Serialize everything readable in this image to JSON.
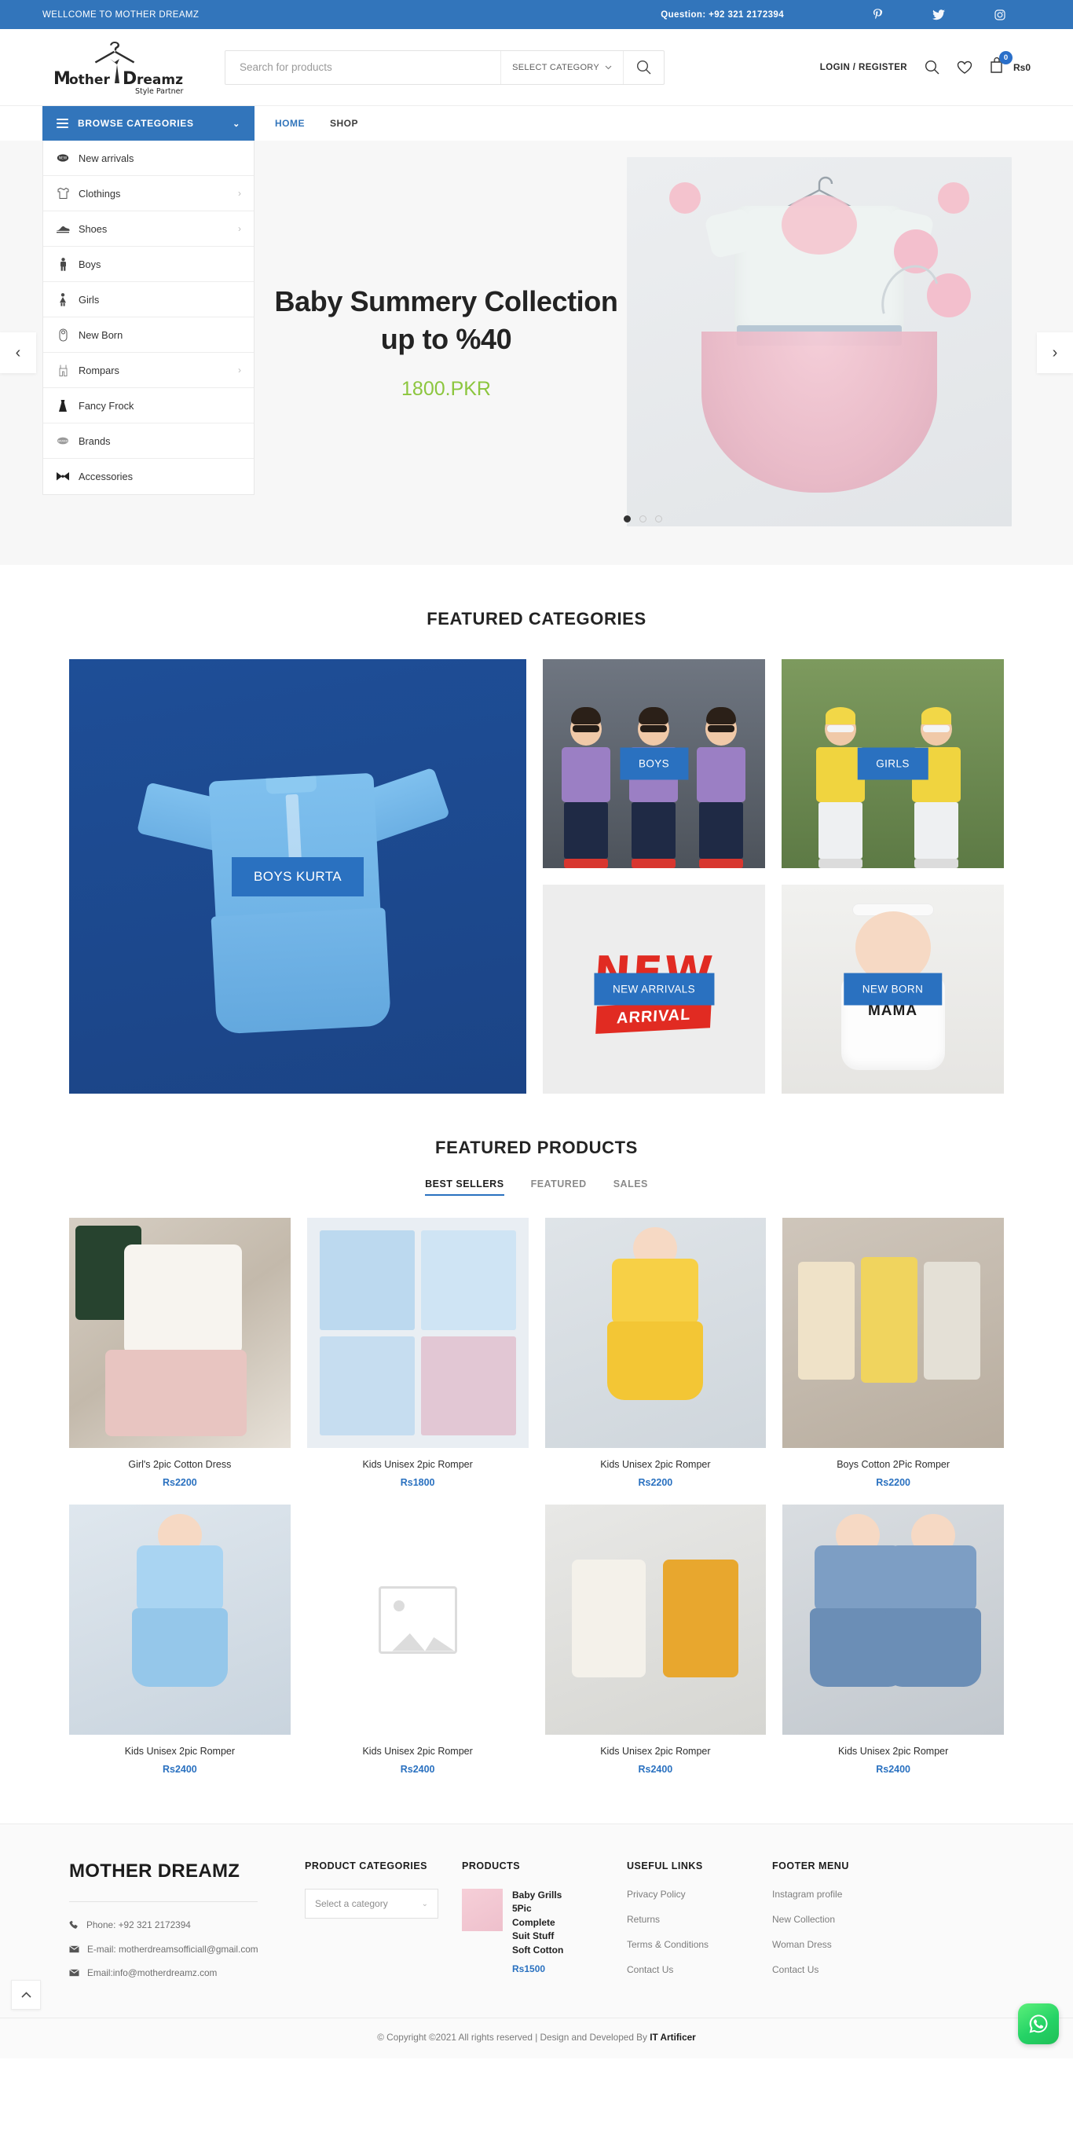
{
  "topbar": {
    "welcome": "WELLCOME TO MOTHER DREAMZ",
    "question": "Question: +92 321 2172394",
    "socials": [
      {
        "name": "pinterest-icon",
        "label": "Pinterest"
      },
      {
        "name": "twitter-icon",
        "label": "Twitter"
      },
      {
        "name": "instagram-icon",
        "label": "Instagram"
      }
    ]
  },
  "header": {
    "logo_name": "Mother",
    "logo_name2": "reamz",
    "logo_tagline": "Style Partner",
    "search_placeholder": "Search for products",
    "search_value": "",
    "select_category": "SELECT CATEGORY",
    "login": "LOGIN / REGISTER",
    "cart_count": "0",
    "cart_total": "Rs0"
  },
  "nav": {
    "browse": "BROWSE CATEGORIES",
    "links": [
      {
        "label": "HOME",
        "active": true
      },
      {
        "label": "SHOP",
        "active": false
      }
    ]
  },
  "categories": [
    {
      "label": "New arrivals",
      "has_sub": false,
      "icon": "new-badge-icon"
    },
    {
      "label": "Clothings",
      "has_sub": true,
      "icon": "shirt-icon"
    },
    {
      "label": "Shoes",
      "has_sub": true,
      "icon": "shoe-icon"
    },
    {
      "label": "Boys",
      "has_sub": false,
      "icon": "boy-icon"
    },
    {
      "label": "Girls",
      "has_sub": false,
      "icon": "girl-icon"
    },
    {
      "label": "New Born",
      "has_sub": false,
      "icon": "baby-icon"
    },
    {
      "label": "Rompars",
      "has_sub": true,
      "icon": "romper-icon"
    },
    {
      "label": "Fancy Frock",
      "has_sub": false,
      "icon": "dress-icon"
    },
    {
      "label": "Brands",
      "has_sub": false,
      "icon": "brand-icon"
    },
    {
      "label": "Accessories",
      "has_sub": false,
      "icon": "bow-icon"
    }
  ],
  "hero": {
    "title": "Baby Summery Collection up to %40",
    "price": "1800.PKR",
    "prev": "‹",
    "next": "›",
    "dots": [
      true,
      false,
      false
    ]
  },
  "featured_categories": {
    "title": "FEATURED CATEGORIES",
    "items": [
      {
        "label": "BOYS KURTA",
        "style": "big"
      },
      {
        "label": "BOYS",
        "style": "small"
      },
      {
        "label": "GIRLS",
        "style": "small"
      },
      {
        "label": "NEW ARRIVALS",
        "style": "small"
      },
      {
        "label": "NEW BORN",
        "style": "small"
      }
    ]
  },
  "featured_products": {
    "title": "FEATURED PRODUCTS",
    "tabs": [
      {
        "label": "BEST SELLERS",
        "active": true
      },
      {
        "label": "FEATURED",
        "active": false
      },
      {
        "label": "SALES",
        "active": false
      }
    ],
    "items": [
      {
        "name": "Girl's 2pic Cotton Dress",
        "price": "Rs2200"
      },
      {
        "name": "Kids Unisex 2pic Romper",
        "price": "Rs1800"
      },
      {
        "name": "Kids Unisex 2pic Romper",
        "price": "Rs2200"
      },
      {
        "name": "Boys Cotton 2Pic Romper",
        "price": "Rs2200"
      },
      {
        "name": "Kids Unisex 2pic Romper",
        "price": "Rs2400"
      },
      {
        "name": "Kids Unisex 2pic Romper",
        "price": "Rs2400"
      },
      {
        "name": "Kids Unisex 2pic Romper",
        "price": "Rs2400"
      },
      {
        "name": "Kids Unisex 2pic Romper",
        "price": "Rs2400"
      }
    ]
  },
  "footer": {
    "brand": "MOTHER DREAMZ",
    "phone": "Phone: +92 321 2172394",
    "email1": "E-mail: motherdreamsofficiall@gmail.com",
    "email2": "Email:info@motherdreamz.com",
    "categories_head": "PRODUCT CATEGORIES",
    "categories_select": "Select a category",
    "products_head": "PRODUCTS",
    "product": {
      "name": "Baby Grills 5Pic Complete Suit Stuff Soft Cotton",
      "price": "Rs1500"
    },
    "useful_head": "USEFUL LINKS",
    "useful_links": [
      "Privacy Policy",
      "Returns",
      "Terms & Conditions",
      "Contact Us"
    ],
    "menu_head": "FOOTER MENU",
    "menu_links": [
      "Instagram profile",
      "New Collection",
      "Woman Dress",
      "Contact Us"
    ],
    "copyright_pre": "© Copyright ©2021 All rights reserved | Design and Developed By ",
    "copyright_brand": "IT Artificer"
  },
  "floating": {
    "to_top": "^",
    "whatsapp": "whatsapp-icon"
  },
  "colors": {
    "brand_blue": "#3275bb",
    "link_blue": "#2a71c0",
    "price_green": "#8cc63e",
    "whatsapp_green": "#25d366"
  }
}
